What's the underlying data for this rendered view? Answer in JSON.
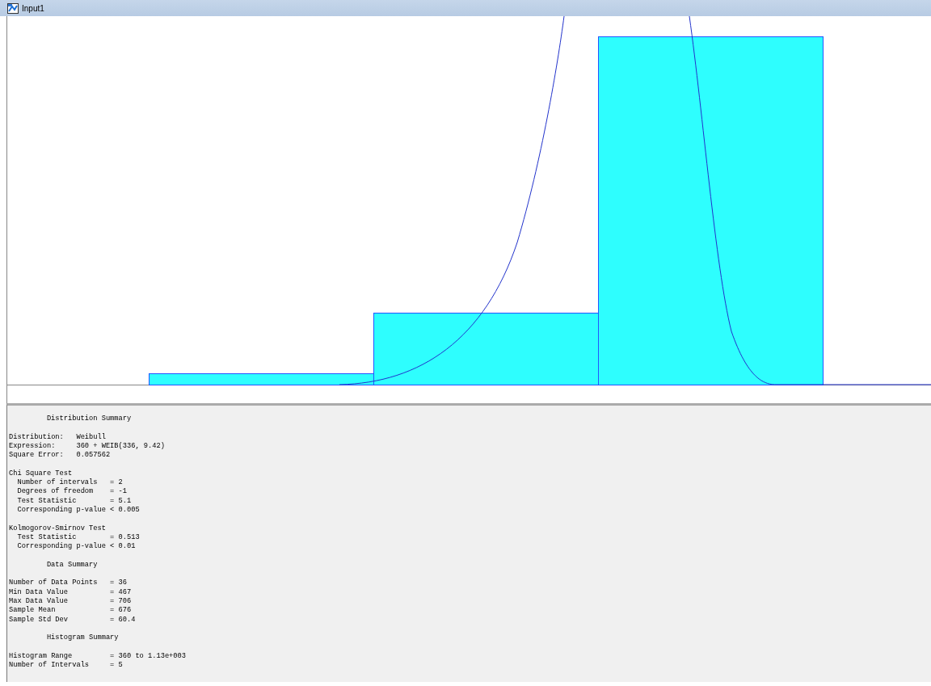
{
  "window": {
    "title": "Input1"
  },
  "report": [
    {
      "title": "Distribution Summary",
      "lines": [
        "Distribution:   Weibull",
        "Expression:     360 + WEIB(336, 9.42)",
        "Square Error:   0.057562"
      ]
    },
    {
      "lines": [
        "Chi Square Test",
        "  Number of intervals   = 2",
        "  Degrees of freedom    = -1",
        "  Test Statistic        = 5.1",
        "  Corresponding p-value < 0.005"
      ]
    },
    {
      "lines": [
        "Kolmogorov-Smirnov Test",
        "  Test Statistic        = 0.513",
        "  Corresponding p-value < 0.01"
      ]
    },
    {
      "title": "Data Summary",
      "lines": [
        "Number of Data Points   = 36",
        "Min Data Value          = 467",
        "Max Data Value          = 706",
        "Sample Mean             = 676",
        "Sample Std Dev          = 60.4"
      ]
    },
    {
      "title": "Histogram Summary",
      "lines": [
        "Histogram Range         = 360 to 1.13e+003",
        "Number of Intervals     = 5"
      ]
    }
  ]
}
